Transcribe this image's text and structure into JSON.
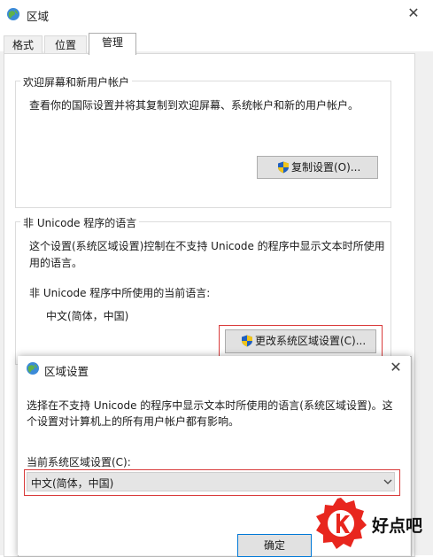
{
  "window": {
    "title": "区域",
    "close": "✕",
    "tabs": [
      {
        "label": "格式"
      },
      {
        "label": "位置"
      },
      {
        "label": "管理"
      }
    ]
  },
  "welcome_group": {
    "label": "欢迎屏幕和新用户帐户",
    "description": "查看你的国际设置并将其复制到欢迎屏幕、系统帐户和新的用户帐户。",
    "copy_button": "复制设置(O)..."
  },
  "unicode_group": {
    "label": "非 Unicode 程序的语言",
    "description_line1": "这个设置(系统区域设置)控制在不支持 Unicode 的程序中显示文本时所使用",
    "description_line2": "用的语言。",
    "current_label": "非 Unicode 程序中所使用的当前语言:",
    "current_value": "中文(简体，中国)",
    "change_button": "更改系统区域设置(C)..."
  },
  "sub_dialog": {
    "title": "区域设置",
    "close": "✕",
    "description_line1": "选择在不支持 Unicode 的程序中显示文本时所使用的语言(系统区域设置)。这",
    "description_line2": "个设置对计算机上的所有用户帐户都有影响。",
    "select_label": "当前系统区域设置(C):",
    "select_value": "中文(简体，中国)",
    "ok_button": "确定"
  },
  "watermark": {
    "text": "好点吧",
    "color": "#e8261e"
  }
}
